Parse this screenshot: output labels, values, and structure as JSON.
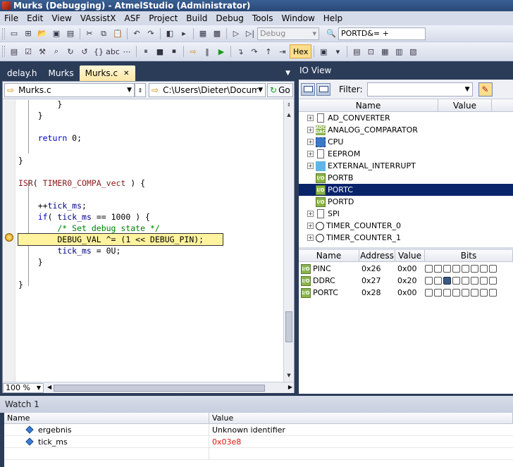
{
  "window": {
    "title": "Murks (Debugging) - AtmelStudio (Administrator)"
  },
  "menu": [
    "File",
    "Edit",
    "View",
    "VAssistX",
    "ASF",
    "Project",
    "Build",
    "Debug",
    "Tools",
    "Window",
    "Help"
  ],
  "toolbar": {
    "config_value": "Debug",
    "find_value": "PORTD&= +",
    "hex_label": "Hex"
  },
  "editor": {
    "tabs": [
      {
        "label": "delay.h"
      },
      {
        "label": "Murks"
      },
      {
        "label": "Murks.c",
        "close": "✕"
      }
    ],
    "file_combo": "Murks.c",
    "path_combo": "C:\\Users\\Dieter\\Docum",
    "go_label": "Go",
    "zoom": "100 %",
    "lines": [
      {
        "text": "        }"
      },
      {
        "text": "    }"
      },
      {
        "text": ""
      },
      {
        "text": "    return 0;"
      },
      {
        "text": ""
      },
      {
        "text": "}"
      },
      {
        "text": ""
      },
      {
        "text": "ISR( TIMER0_COMPA_vect ) {"
      },
      {
        "text": ""
      },
      {
        "text": "    ++tick_ms;"
      },
      {
        "text": "    if( tick_ms == 1000 ) {"
      },
      {
        "text": "        /* Set debug state */"
      },
      {
        "text": "        DEBUG_VAL ^= (1 << DEBUG_PIN);"
      },
      {
        "text": "        tick_ms = 0U;"
      },
      {
        "text": "    }"
      },
      {
        "text": ""
      },
      {
        "text": "}"
      }
    ]
  },
  "io_view": {
    "title": "IO View",
    "filter_label": "Filter:",
    "columns": {
      "name": "Name",
      "value": "Value"
    },
    "modules": [
      {
        "name": "AD_CONVERTER",
        "icon": "doc"
      },
      {
        "name": "ANALOG_COMPARATOR",
        "icon": "adc",
        "icon_text": "ADC DAC"
      },
      {
        "name": "CPU",
        "icon": "cpu"
      },
      {
        "name": "EEPROM",
        "icon": "doc"
      },
      {
        "name": "EXTERNAL_INTERRUPT",
        "icon": "ext"
      },
      {
        "name": "PORTB",
        "icon": "io",
        "icon_text": "I/O"
      },
      {
        "name": "PORTC",
        "icon": "io",
        "icon_text": "I/O",
        "selected": true
      },
      {
        "name": "PORTD",
        "icon": "io",
        "icon_text": "I/O"
      },
      {
        "name": "SPI",
        "icon": "doc"
      },
      {
        "name": "TIMER_COUNTER_0",
        "icon": "timer"
      },
      {
        "name": "TIMER_COUNTER_1",
        "icon": "timer"
      }
    ],
    "register_columns": {
      "name": "Name",
      "address": "Address",
      "value": "Value",
      "bits": "Bits"
    },
    "registers": [
      {
        "name": "PINC",
        "address": "0x26",
        "value": "0x00",
        "bits": [
          0,
          0,
          0,
          0,
          0,
          0,
          0,
          0
        ]
      },
      {
        "name": "DDRC",
        "address": "0x27",
        "value": "0x20",
        "bits": [
          0,
          0,
          1,
          0,
          0,
          0,
          0,
          0
        ]
      },
      {
        "name": "PORTC",
        "address": "0x28",
        "value": "0x00",
        "bits": [
          0,
          0,
          0,
          0,
          0,
          0,
          0,
          0
        ]
      }
    ]
  },
  "watch": {
    "title": "Watch 1",
    "columns": {
      "name": "Name",
      "value": "Value"
    },
    "rows": [
      {
        "name": "ergebnis",
        "value": "Unknown identifier",
        "changed": false
      },
      {
        "name": "tick_ms",
        "value": "0x03e8",
        "changed": true
      }
    ]
  }
}
